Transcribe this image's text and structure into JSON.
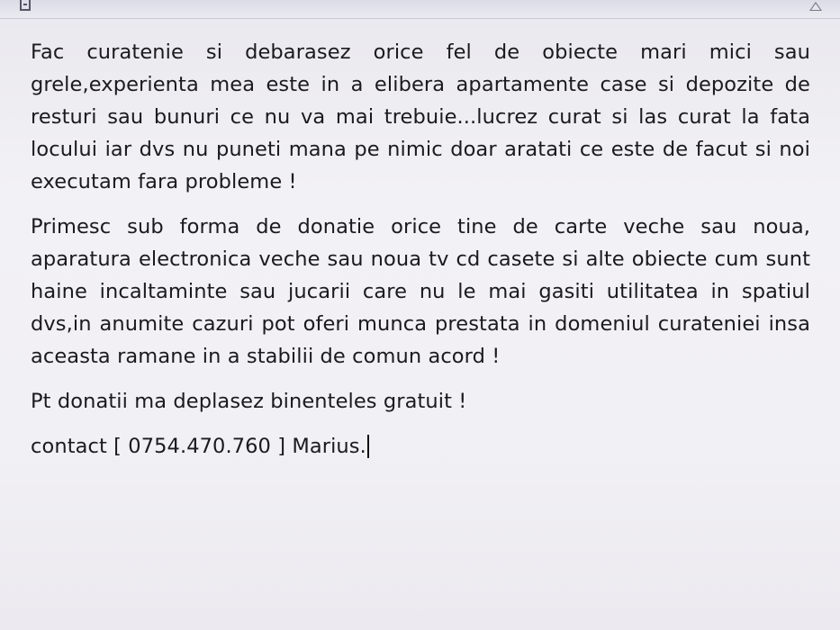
{
  "document": {
    "paragraphs": [
      "Fac curatenie si debarasez orice fel de obiecte mari mici sau grele,experienta mea este in a elibera apartamente case si depozite de resturi sau bunuri ce nu va mai trebuie...lucrez curat si las curat la fata locului iar dvs nu puneti mana pe nimic doar aratati ce este de facut si noi executam fara probleme !",
      "Primesc sub forma de donatie orice tine de carte veche sau noua, aparatura electronica veche sau noua tv cd casete si alte obiecte cum sunt haine incaltaminte sau jucarii care nu le mai gasiti utilitatea in spatiul dvs,in anumite cazuri pot oferi munca prestata in domeniul curateniei insa aceasta ramane in a stabilii de comun acord !",
      "Pt donatii ma deplasez binenteles gratuit !",
      "contact [ 0754.470.760 ] Marius."
    ]
  },
  "icons": {
    "toolbar_left": "save-icon",
    "toolbar_right": "collapse-ribbon-icon"
  },
  "colors": {
    "text": "#1a1a1f",
    "background": "#f1f0f4"
  }
}
